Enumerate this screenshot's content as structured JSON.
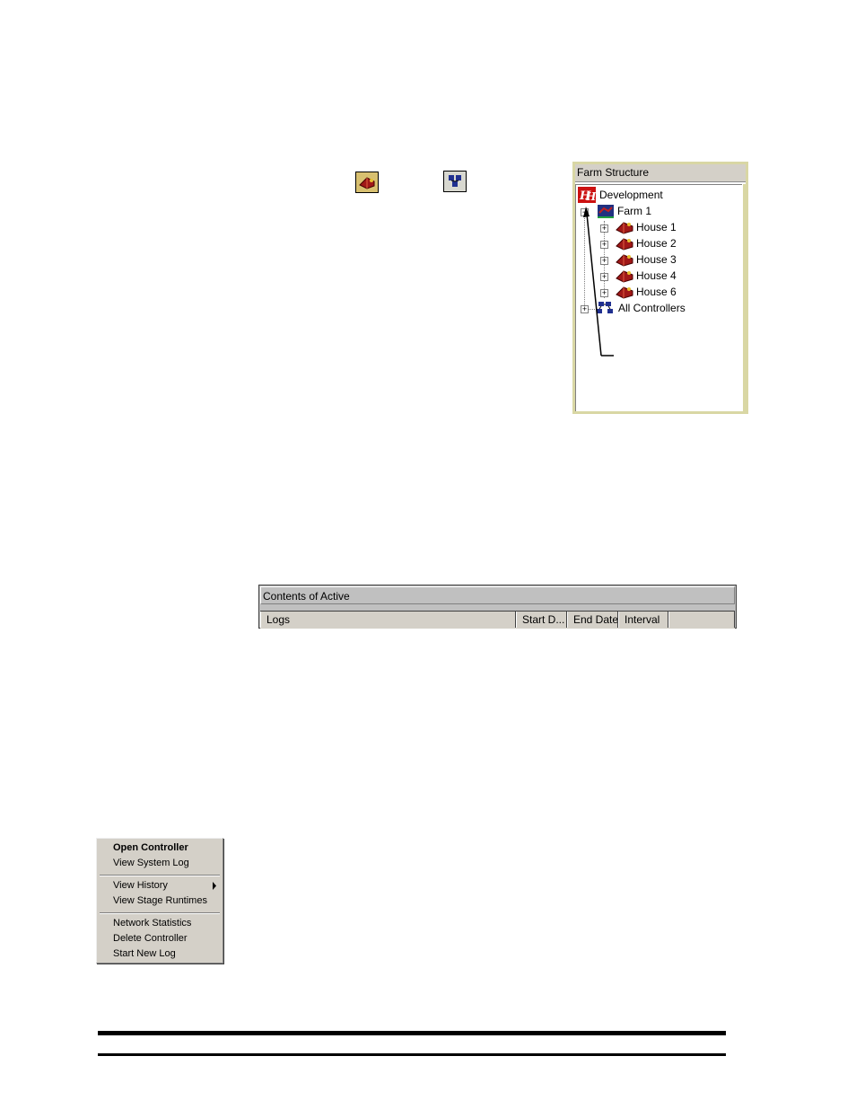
{
  "farm_structure": {
    "title": "Farm Structure",
    "root": {
      "label": "Development",
      "icon": "development-logo-icon"
    },
    "farm": {
      "label": "Farm 1",
      "icon": "farm-icon",
      "expanded": true
    },
    "houses": [
      {
        "label": "House 1",
        "icon": "house-icon"
      },
      {
        "label": "House 2",
        "icon": "house-icon"
      },
      {
        "label": "House 3",
        "icon": "house-icon"
      },
      {
        "label": "House 4",
        "icon": "house-icon"
      },
      {
        "label": "House 6",
        "icon": "house-icon"
      }
    ],
    "all_controllers": {
      "label": "All Controllers",
      "icon": "controllers-icon"
    }
  },
  "contents": {
    "title": "Contents of Active",
    "columns": [
      "Logs",
      "Start D...",
      "End Date",
      "Interval",
      ""
    ]
  },
  "context_menu": {
    "groups": [
      [
        {
          "label": "Open Controller",
          "bold": true
        },
        {
          "label": "View System Log"
        }
      ],
      [
        {
          "label": "View History",
          "submenu": true
        },
        {
          "label": "View Stage Runtimes"
        }
      ],
      [
        {
          "label": "Network Statistics"
        },
        {
          "label": "Delete Controller"
        },
        {
          "label": "Start New Log"
        }
      ]
    ]
  },
  "colors": {
    "panel_border": "#d9d7a4",
    "window_gray": "#d4d0c8",
    "house_red": "#b02020",
    "logo_red": "#cc1111"
  }
}
